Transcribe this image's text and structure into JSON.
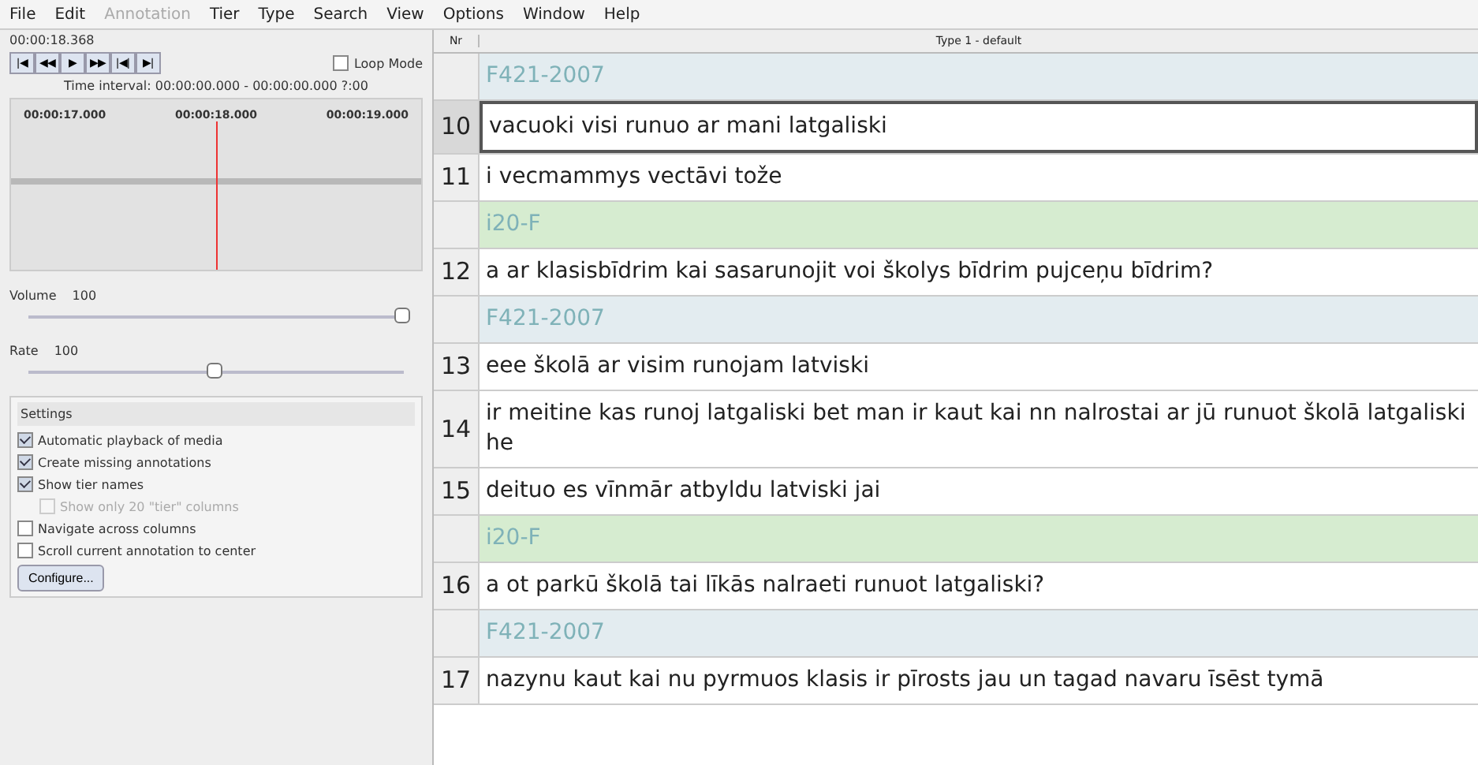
{
  "menu_bar": [
    {
      "label": "File",
      "disabled": false
    },
    {
      "label": "Edit",
      "disabled": false
    },
    {
      "label": "Annotation",
      "disabled": true
    },
    {
      "label": "Tier",
      "disabled": false
    },
    {
      "label": "Type",
      "disabled": false
    },
    {
      "label": "Search",
      "disabled": false
    },
    {
      "label": "View",
      "disabled": false
    },
    {
      "label": "Options",
      "disabled": false
    },
    {
      "label": "Window",
      "disabled": false
    },
    {
      "label": "Help",
      "disabled": false
    }
  ],
  "media": {
    "time": "00:00:18.368",
    "controls": [
      "|◀",
      "◀◀",
      "▶",
      "▶▶",
      "|◀|",
      "▶|"
    ],
    "loop_mode": {
      "label": "Loop Mode",
      "checked": false
    },
    "interval": "Time interval: 00:00:00.000 - 00:00:00.000 ?:00"
  },
  "timeline": {
    "ticks": [
      "00:00:17.000",
      "00:00:18.000",
      "00:00:19.000"
    ]
  },
  "volume": {
    "label": "Volume",
    "reading": "100",
    "level": 1.0
  },
  "rate": {
    "label": "Rate",
    "reading": "100",
    "level": 0.5
  },
  "settings": {
    "title": "Settings",
    "options": [
      {
        "kind": "option",
        "label": "Automatic playback of media",
        "checked": true,
        "disabled": false
      },
      {
        "kind": "option",
        "label": "Create missing annotations",
        "checked": true,
        "disabled": false
      },
      {
        "kind": "option",
        "label": "Show tier names",
        "checked": true,
        "disabled": false
      },
      {
        "kind": "suboption",
        "label": "Show only 20 \"tier\" columns",
        "checked": false,
        "disabled": true
      },
      {
        "kind": "option",
        "label": "Navigate across columns",
        "checked": false,
        "disabled": false
      },
      {
        "kind": "option",
        "label": "Scroll current annotation to center",
        "checked": false,
        "disabled": false
      }
    ],
    "button": "Configure..."
  },
  "table": {
    "columns": [
      "Nr",
      "Type 1 - default"
    ],
    "rows": [
      {
        "kind": "tier",
        "text": "F421-2007",
        "color": "#e3ecf0"
      },
      {
        "kind": "annotation",
        "nr": "10",
        "text": "vacuoki visi runuo ar mani latgaliski",
        "selected": true
      },
      {
        "kind": "annotation",
        "nr": "11",
        "text": "i vecmammys vectāvi tože",
        "selected": false
      },
      {
        "kind": "tier",
        "text": "i20-F",
        "color": "#d6ecd0"
      },
      {
        "kind": "annotation",
        "nr": "12",
        "text": "a ar klasisbīdrim kai sasarunojit voi školys bīdrim pujceņu bīdrim?",
        "selected": false
      },
      {
        "kind": "tier",
        "text": "F421-2007",
        "color": "#e3ecf0"
      },
      {
        "kind": "annotation",
        "nr": "13",
        "text": "eee školā ar visim runojam latviski",
        "selected": false
      },
      {
        "kind": "annotation",
        "nr": "14",
        "text": "ir meitine kas runoj latgaliski bet man ir kaut kai nn nalrostai ar jū runuot školā latgaliski he",
        "selected": false
      },
      {
        "kind": "annotation",
        "nr": "15",
        "text": "deituo es vīnmār atbyldu latviski jai",
        "selected": false
      },
      {
        "kind": "tier",
        "text": "i20-F",
        "color": "#d6ecd0"
      },
      {
        "kind": "annotation",
        "nr": "16",
        "text": "a ot parkū školā tai līkās nalraeti runuot latgaliski?",
        "selected": false
      },
      {
        "kind": "tier",
        "text": "F421-2007",
        "color": "#e3ecf0"
      },
      {
        "kind": "annotation",
        "nr": "17",
        "text": "nazynu kaut kai nu pyrmuos klasis ir pīrosts jau un tagad navaru īsēst tymā",
        "selected": false
      }
    ]
  }
}
